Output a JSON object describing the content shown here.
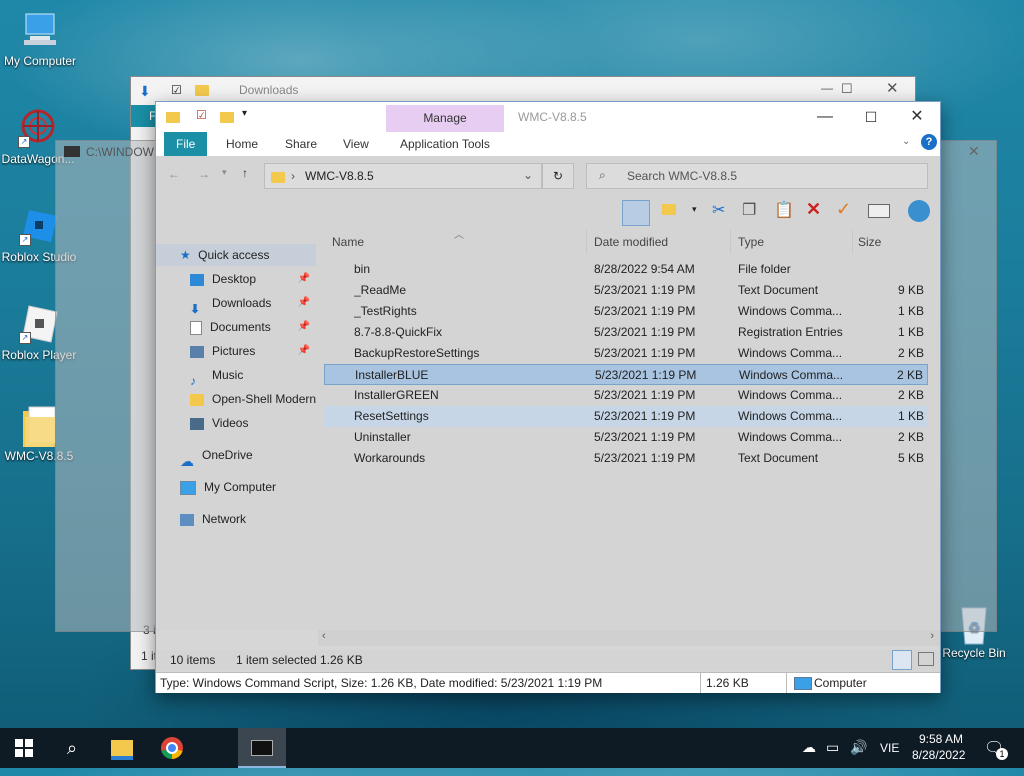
{
  "desktop": {
    "icons": [
      {
        "label": "My Computer"
      },
      {
        "label": "DataWagon..."
      },
      {
        "label": "Roblox Studio"
      },
      {
        "label": "Roblox Player"
      },
      {
        "label": "WMC-V8.8.5"
      }
    ],
    "recycle_bin": "Recycle Bin"
  },
  "back_window": {
    "title": "Downloads",
    "partial_label": "F",
    "status_partial": "3 i",
    "status_partial2": "1 ite"
  },
  "cmd_window": {
    "title": "C:\\WINDOWS\\system32\\cmd.exe"
  },
  "window": {
    "title": "WMC-V8.8.5",
    "manage_label": "Manage",
    "tabs": [
      "File",
      "Home",
      "Share",
      "View",
      "Application Tools"
    ],
    "address": "WMC-V8.8.5",
    "search_placeholder": "Search WMC-V8.8.5",
    "columns": {
      "name": "Name",
      "date": "Date modified",
      "type": "Type",
      "size": "Size"
    },
    "nav": {
      "quick_access": "Quick access",
      "items": [
        "Desktop",
        "Downloads",
        "Documents",
        "Pictures",
        "Music",
        "Open-Shell Modern",
        "Videos"
      ],
      "onedrive": "OneDrive",
      "mycomputer": "My Computer",
      "network": "Network"
    },
    "files": [
      {
        "name": "bin",
        "date": "8/28/2022 9:54 AM",
        "type": "File folder",
        "size": ""
      },
      {
        "name": "_ReadMe",
        "date": "5/23/2021 1:19 PM",
        "type": "Text Document",
        "size": "9 KB"
      },
      {
        "name": "_TestRights",
        "date": "5/23/2021 1:19 PM",
        "type": "Windows Comma...",
        "size": "1 KB"
      },
      {
        "name": "8.7-8.8-QuickFix",
        "date": "5/23/2021 1:19 PM",
        "type": "Registration Entries",
        "size": "1 KB"
      },
      {
        "name": "BackupRestoreSettings",
        "date": "5/23/2021 1:19 PM",
        "type": "Windows Comma...",
        "size": "2 KB"
      },
      {
        "name": "InstallerBLUE",
        "date": "5/23/2021 1:19 PM",
        "type": "Windows Comma...",
        "size": "2 KB"
      },
      {
        "name": "InstallerGREEN",
        "date": "5/23/2021 1:19 PM",
        "type": "Windows Comma...",
        "size": "2 KB"
      },
      {
        "name": "ResetSettings",
        "date": "5/23/2021 1:19 PM",
        "type": "Windows Comma...",
        "size": "1 KB"
      },
      {
        "name": "Uninstaller",
        "date": "5/23/2021 1:19 PM",
        "type": "Windows Comma...",
        "size": "2 KB"
      },
      {
        "name": "Workarounds",
        "date": "5/23/2021 1:19 PM",
        "type": "Text Document",
        "size": "5 KB"
      }
    ],
    "status": {
      "count": "10 items",
      "selected": "1 item selected",
      "size": "1.26 KB"
    },
    "details": {
      "text": "Type: Windows Command Script, Size: 1.26 KB, Date modified: 5/23/2021 1:19 PM",
      "size": "1.26 KB",
      "location": "Computer"
    }
  },
  "taskbar": {
    "lang": "VIE",
    "time": "9:58 AM",
    "date": "8/28/2022",
    "notif_count": "1"
  },
  "colors": {
    "selection": "#a9c4e0",
    "manage_tab": "#e7cdf2",
    "file_tab": "#1a8fa6"
  }
}
